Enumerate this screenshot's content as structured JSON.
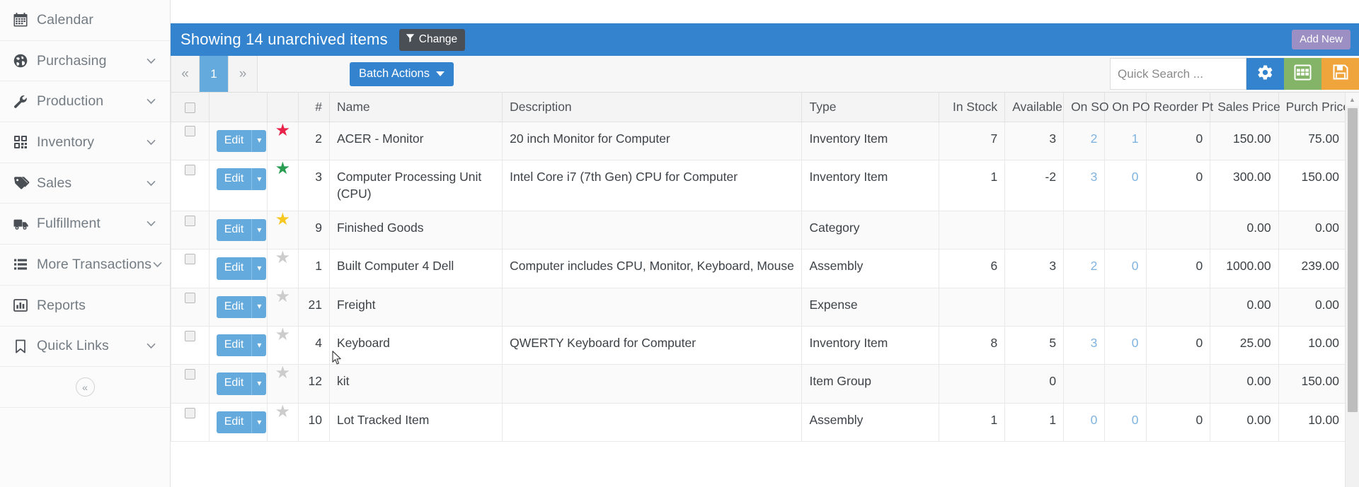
{
  "sidebar": {
    "items": [
      {
        "label": "Calendar",
        "icon": "calendar-icon",
        "has_caret": false
      },
      {
        "label": "Purchasing",
        "icon": "globe-icon",
        "has_caret": true
      },
      {
        "label": "Production",
        "icon": "wrench-icon",
        "has_caret": true
      },
      {
        "label": "Inventory",
        "icon": "qrcode-icon",
        "has_caret": true
      },
      {
        "label": "Sales",
        "icon": "tag-icon",
        "has_caret": true
      },
      {
        "label": "Fulfillment",
        "icon": "truck-icon",
        "has_caret": true
      },
      {
        "label": "More Transactions",
        "icon": "list-icon",
        "has_caret": true
      },
      {
        "label": "Reports",
        "icon": "bar-chart-icon",
        "has_caret": false
      },
      {
        "label": "Quick Links",
        "icon": "bookmark-icon",
        "has_caret": true
      }
    ],
    "collapse_glyph": "«"
  },
  "titlebar": {
    "text": "Showing 14 unarchived items",
    "change_label": "Change",
    "add_new_label": "Add New",
    "bg_color": "#3483ce",
    "change_bg": "#4a4f55",
    "add_new_bg": "#9b8fc4"
  },
  "toolbar": {
    "pager": [
      {
        "label": "«",
        "active": false
      },
      {
        "label": "1",
        "active": true
      },
      {
        "label": "»",
        "active": false
      }
    ],
    "batch_actions_label": "Batch Actions",
    "search_placeholder": "Quick Search ...",
    "search_value": "",
    "icons": [
      {
        "name": "gear-icon",
        "color": "#3483ce"
      },
      {
        "name": "grid-icon",
        "color": "#84b468"
      },
      {
        "name": "save-icon",
        "color": "#f0a53c"
      }
    ]
  },
  "table": {
    "headers": [
      "",
      "",
      "",
      "#",
      "Name",
      "Description",
      "Type",
      "In Stock",
      "Available",
      "On SO",
      "On PO",
      "Reorder Pt",
      "Sales Price",
      "Purch Price"
    ],
    "edit_label": "Edit",
    "rows": [
      {
        "star_color": "#e8234a",
        "num": "2",
        "name": "ACER - Monitor",
        "description": "20 inch Monitor for Computer",
        "type": "Inventory Item",
        "in_stock": "7",
        "available": "3",
        "on_so": "2",
        "on_po": "1",
        "reorder_pt": "0",
        "sales_price": "150.00",
        "purch_price": "75.00"
      },
      {
        "star_color": "#2a9d52",
        "num": "3",
        "name": "Computer Processing Unit (CPU)",
        "description": "Intel Core i7 (7th Gen) CPU for Computer",
        "type": "Inventory Item",
        "in_stock": "1",
        "available": "-2",
        "on_so": "3",
        "on_po": "0",
        "reorder_pt": "0",
        "sales_price": "300.00",
        "purch_price": "150.00"
      },
      {
        "star_color": "#f7c822",
        "num": "9",
        "name": "Finished Goods",
        "description": "",
        "type": "Category",
        "in_stock": "",
        "available": "",
        "on_so": "",
        "on_po": "",
        "reorder_pt": "",
        "sales_price": "0.00",
        "purch_price": "0.00"
      },
      {
        "star_color": "#cccccc",
        "num": "1",
        "name": "Built Computer 4 Dell",
        "description": "Computer includes CPU, Monitor, Keyboard, Mouse",
        "type": "Assembly",
        "in_stock": "6",
        "available": "3",
        "on_so": "2",
        "on_po": "0",
        "reorder_pt": "0",
        "sales_price": "1000.00",
        "purch_price": "239.00"
      },
      {
        "star_color": "#cccccc",
        "num": "21",
        "name": "Freight",
        "description": "",
        "type": "Expense",
        "in_stock": "",
        "available": "",
        "on_so": "",
        "on_po": "",
        "reorder_pt": "",
        "sales_price": "0.00",
        "purch_price": "0.00"
      },
      {
        "star_color": "#cccccc",
        "num": "4",
        "name": "Keyboard",
        "description": "QWERTY Keyboard for Computer",
        "type": "Inventory Item",
        "in_stock": "8",
        "available": "5",
        "on_so": "3",
        "on_po": "0",
        "reorder_pt": "0",
        "sales_price": "25.00",
        "purch_price": "10.00"
      },
      {
        "star_color": "#cccccc",
        "num": "12",
        "name": "kit",
        "description": "",
        "type": "Item Group",
        "in_stock": "",
        "available": "0",
        "on_so": "",
        "on_po": "",
        "reorder_pt": "",
        "sales_price": "0.00",
        "purch_price": "150.00"
      },
      {
        "star_color": "#cccccc",
        "num": "10",
        "name": "Lot Tracked Item",
        "description": "",
        "type": "Assembly",
        "in_stock": "1",
        "available": "1",
        "on_so": "0",
        "on_po": "0",
        "reorder_pt": "0",
        "sales_price": "0.00",
        "purch_price": "10.00"
      }
    ]
  }
}
